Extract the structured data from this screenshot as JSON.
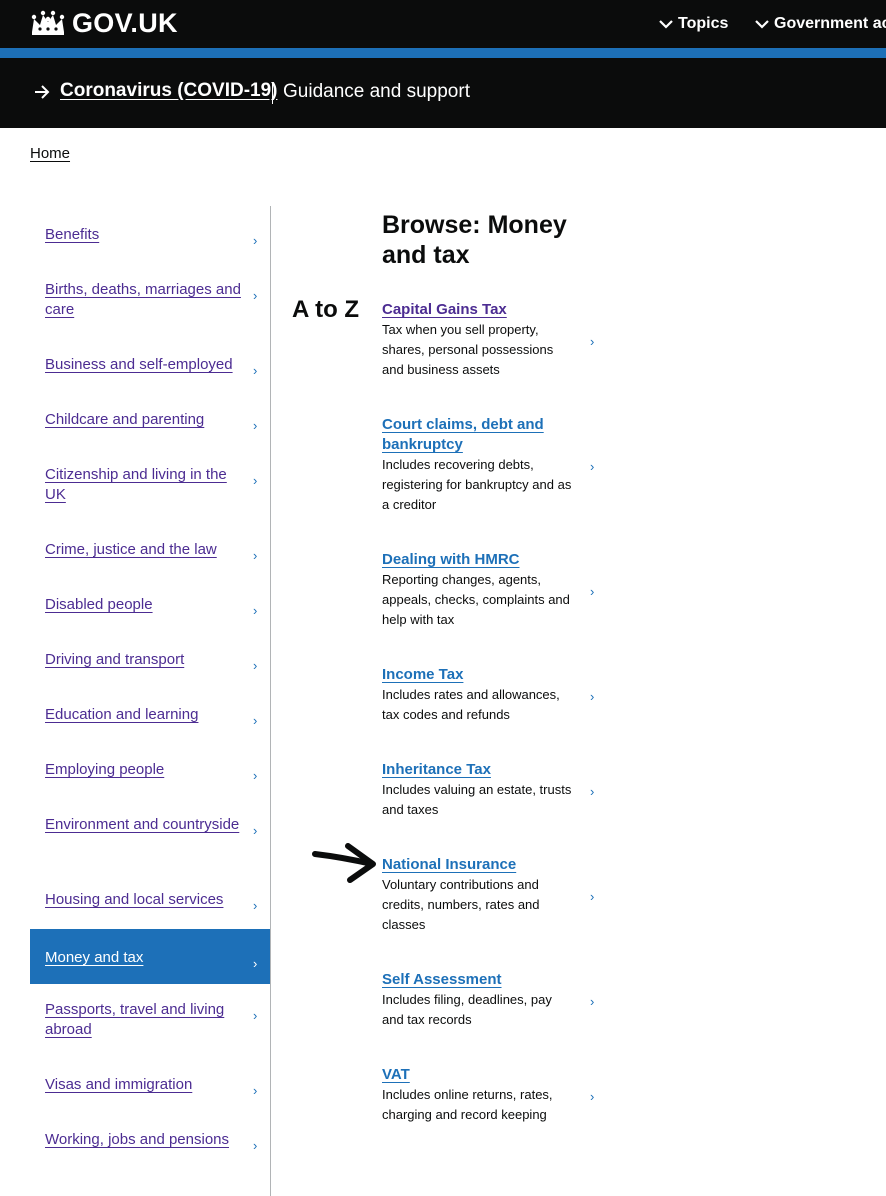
{
  "header": {
    "logo_text": "GOV.UK",
    "nav": [
      {
        "label": "Topics"
      },
      {
        "label": "Government ac"
      }
    ]
  },
  "covid_banner": {
    "link_label": "Coronavirus (COVID-19)",
    "text": "Guidance and support"
  },
  "breadcrumb": {
    "home": "Home"
  },
  "sidebar": {
    "items": [
      {
        "label": "Benefits"
      },
      {
        "label": "Births, deaths, marriages and care"
      },
      {
        "label": "Business and self-employed"
      },
      {
        "label": "Childcare and parenting"
      },
      {
        "label": "Citizenship and living in the UK"
      },
      {
        "label": "Crime, justice and the law"
      },
      {
        "label": "Disabled people"
      },
      {
        "label": "Driving and transport"
      },
      {
        "label": "Education and learning"
      },
      {
        "label": "Employing people"
      },
      {
        "label": "Environment and countryside"
      },
      {
        "label": "Housing and local services"
      },
      {
        "label": "Money and tax"
      },
      {
        "label": "Passports, travel and living abroad"
      },
      {
        "label": "Visas and immigration"
      },
      {
        "label": "Working, jobs and pensions"
      }
    ],
    "selected": "Money and tax",
    "chevron": "›"
  },
  "atoz": "A to Z",
  "main": {
    "title": "Browse: Money and tax",
    "topics": [
      {
        "title": "Capital Gains Tax",
        "description": "Tax when you sell property, shares, personal possessions and business assets"
      },
      {
        "title": "Court claims, debt and bankruptcy",
        "description": "Includes recovering debts, registering for bankruptcy and as a creditor"
      },
      {
        "title": "Dealing with HMRC",
        "description": "Reporting changes, agents, appeals, checks, complaints and help with tax"
      },
      {
        "title": "Income Tax",
        "description": "Includes rates and allowances, tax codes and refunds"
      },
      {
        "title": "Inheritance Tax",
        "description": "Includes valuing an estate, trusts and taxes"
      },
      {
        "title": "National Insurance",
        "description": "Voluntary contributions and credits, numbers, rates and classes"
      },
      {
        "title": "Self Assessment",
        "description": "Includes filing, deadlines, pay and tax records"
      },
      {
        "title": "VAT",
        "description": "Includes online returns, rates, charging and record keeping"
      }
    ]
  },
  "colors": {
    "header_bg": "#0b0c0c",
    "brand_blue": "#1d70b8",
    "visited_purple": "#4c2c92",
    "divider": "#b1b4b6"
  },
  "icons": {
    "logo": "crown-icon",
    "nav": "chevron-down-icon",
    "banner": "arrow-right-icon",
    "row": "chevron-right-icon",
    "annotation": "hand-drawn-arrow-icon"
  }
}
